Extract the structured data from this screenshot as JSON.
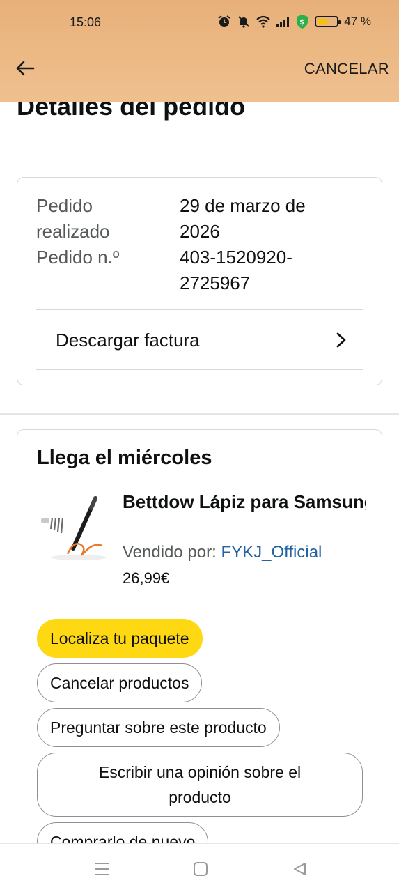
{
  "status_bar": {
    "time": "15:06",
    "battery_text": "47 %",
    "battery_level": 0.47,
    "icons": [
      "alarm-icon",
      "mute-icon",
      "wifi-icon",
      "signal-icon",
      "shield-dollar-icon",
      "battery-icon"
    ]
  },
  "header": {
    "back_icon": "arrow-left-icon",
    "cancel_label": "CANCELAR"
  },
  "page": {
    "title": "Detalles del pedido"
  },
  "order_summary": {
    "placed_label": "Pedido realizado",
    "placed_value": "29 de marzo de 2026",
    "number_label": "Pedido n.º",
    "number_value": "403-1520920-2725967",
    "invoice_label": "Descargar factura"
  },
  "shipment": {
    "title": "Llega el miércoles",
    "product": {
      "name": "Bettdow Lápiz para Samsung Galaxy Tab S...",
      "sold_by_label": "Vendido por:",
      "seller": "FYKJ_Official",
      "price": "26,99€"
    },
    "actions": [
      {
        "label": "Localiza tu paquete",
        "primary": true
      },
      {
        "label": "Cancelar productos",
        "primary": false
      },
      {
        "label": "Preguntar sobre este producto",
        "primary": false
      },
      {
        "label": "Escribir una opinión sobre el producto",
        "primary": false
      },
      {
        "label": "Comprarlo de nuevo",
        "primary": false
      }
    ]
  },
  "colors": {
    "header_bg": "#ecb985",
    "primary_button": "#ffd814",
    "link": "#2162a1",
    "muted_text": "#565959",
    "border": "#d5d9d9"
  },
  "nav_bar": {
    "icons": [
      "menu-icon",
      "home-icon",
      "back-triangle-icon"
    ]
  }
}
